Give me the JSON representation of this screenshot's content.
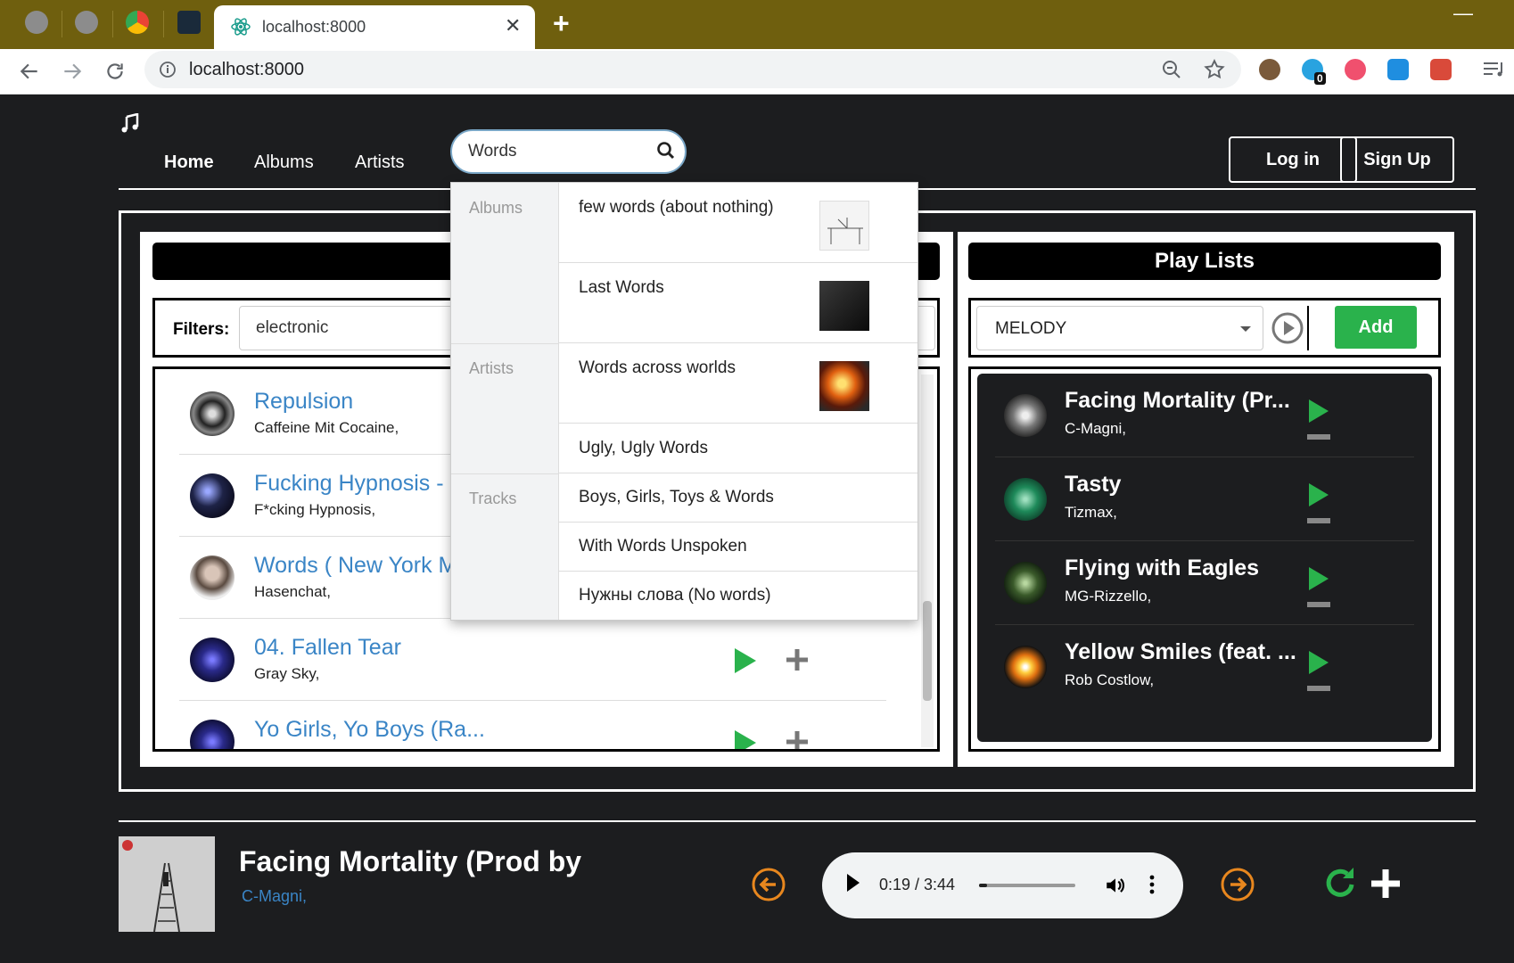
{
  "browser": {
    "tab_title": "localhost:8000",
    "tab_close": "✕",
    "new_tab": "+",
    "url": "localhost:8000",
    "minimize": "—",
    "extension_badge": "0"
  },
  "nav": {
    "home": "Home",
    "albums": "Albums",
    "artists": "Artists",
    "login": "Log in",
    "signup": "Sign Up"
  },
  "search": {
    "value": "Words"
  },
  "dropdown": {
    "categories": {
      "albums": "Albums",
      "artists": "Artists",
      "tracks": "Tracks"
    },
    "albums": [
      "few words (about nothing)",
      "Last Words"
    ],
    "artists": [
      "Words across worlds",
      "Ugly, Ugly Words"
    ],
    "tracks": [
      "Boys, Girls, Toys & Words",
      "With Words Unspoken",
      "Нужны слова (No words)"
    ]
  },
  "filters": {
    "label": "Filters:",
    "value": "electronic"
  },
  "tracks": [
    {
      "title": "Repulsion",
      "artist": "Caffeine Mit Cocaine,"
    },
    {
      "title": "Fucking Hypnosis - B",
      "artist": "F*cking Hypnosis,"
    },
    {
      "title": "Words ( New York M",
      "artist": "Hasenchat,"
    },
    {
      "title": "04. Fallen Tear",
      "artist": "Gray Sky,"
    },
    {
      "title": "Yo Girls, Yo Boys (Ra...",
      "artist": ""
    }
  ],
  "playlists": {
    "header": "Play Lists",
    "selected": "MELODY",
    "add_label": "Add",
    "items": [
      {
        "title": "Facing Mortality (Pr...",
        "artist": "C-Magni,"
      },
      {
        "title": "Tasty",
        "artist": "Tizmax,"
      },
      {
        "title": "Flying with Eagles",
        "artist": "MG-Rizzello,"
      },
      {
        "title": "Yellow Smiles (feat. ...",
        "artist": "Rob Costlow,"
      }
    ]
  },
  "player": {
    "title": "Facing Mortality (Prod by",
    "artist": "C-Magni,",
    "time": "0:19 / 3:44",
    "progress_fraction": 0.085
  },
  "colors": {
    "accent_blue": "#3a85c6",
    "play_green": "#2ab24c",
    "orange": "#e8871e",
    "chrome_bar": "#6f5f0e"
  }
}
